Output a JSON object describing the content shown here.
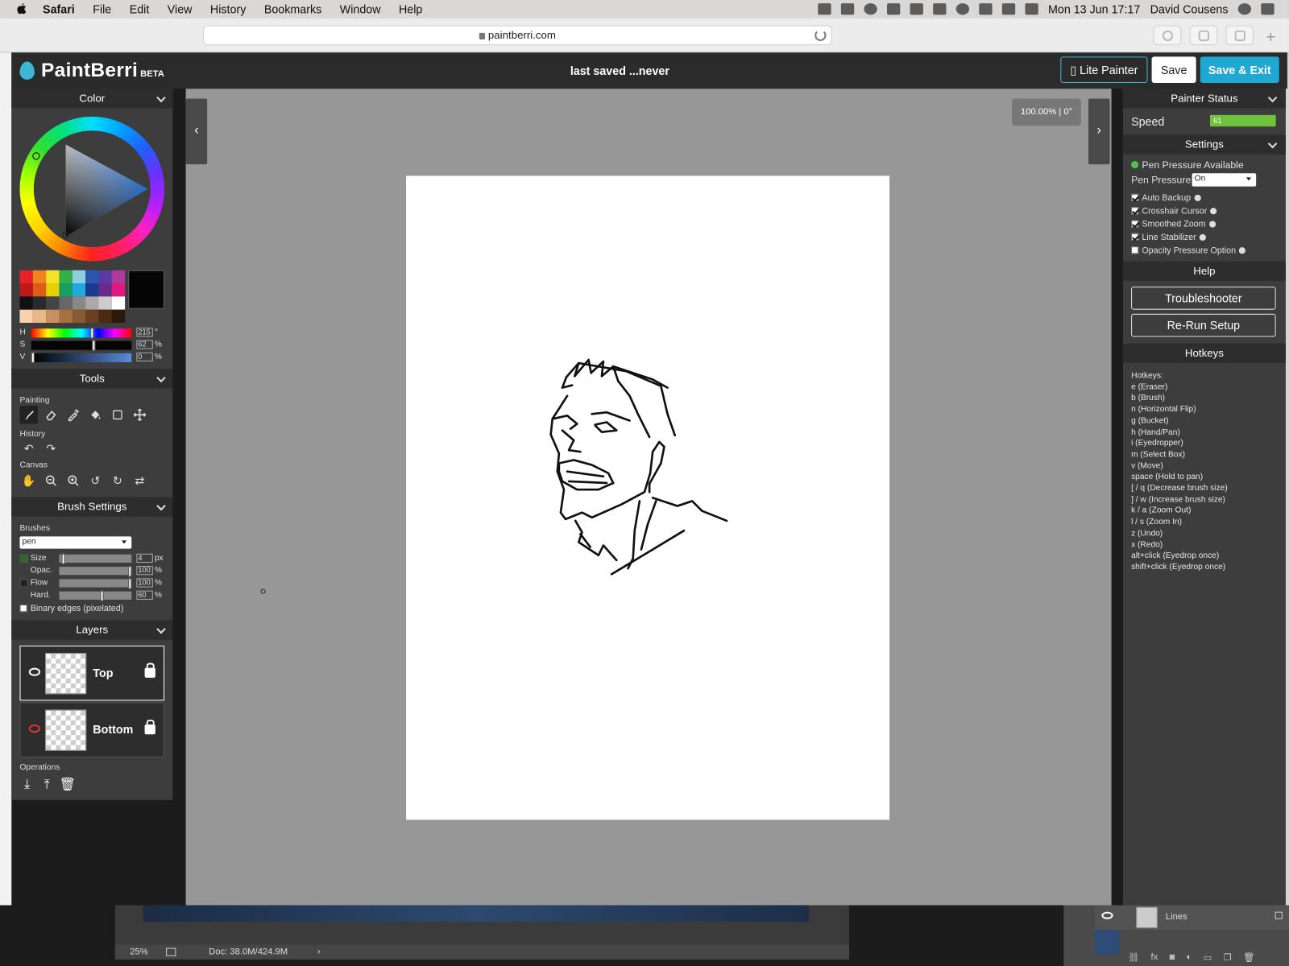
{
  "menubar": {
    "app": "Safari",
    "items": [
      "File",
      "Edit",
      "View",
      "History",
      "Bookmarks",
      "Window",
      "Help"
    ],
    "clock": "Mon 13 Jun  17:17",
    "user": "David Cousens"
  },
  "browser": {
    "url": "paintberri.com"
  },
  "header": {
    "logo": "PaintBerri",
    "beta": "BETA",
    "status": "last saved ...never",
    "lite_button": "▯ Lite Painter",
    "save_button": "Save",
    "save_exit_button": "Save & Exit"
  },
  "color_panel": {
    "title": "Color",
    "swatches": [
      "#e8202a",
      "#f08020",
      "#f4e22a",
      "#33b04a",
      "#8cd0e0",
      "#2a56b0",
      "#5a3aa0",
      "#b03a9a",
      "#c01818",
      "#e05a18",
      "#e8d000",
      "#16a060",
      "#20a8e0",
      "#1a3a90",
      "#6a2a8a",
      "#e01880",
      "#111111",
      "#2a2a2a",
      "#444444",
      "#666666",
      "#888888",
      "#aaaaaa",
      "#cccccc",
      "#ffffff",
      "#f8d0b0",
      "#e8b888",
      "#c89060",
      "#a87040",
      "#8a5a30",
      "#6a4020",
      "#4a2a10",
      "#2a1808"
    ],
    "hsv": {
      "h_label": "H",
      "s_label": "S",
      "v_label": "V",
      "h": "215",
      "s": "62",
      "v": "0",
      "h_unit": "°",
      "s_unit": "%",
      "v_unit": "%"
    }
  },
  "tools_panel": {
    "title": "Tools",
    "painting_label": "Painting",
    "history_label": "History",
    "canvas_label": "Canvas"
  },
  "brush_panel": {
    "title": "Brush Settings",
    "brushes_label": "Brushes",
    "brush_selected": "pen",
    "size_label": "Size",
    "size_value": "4",
    "size_unit": "px",
    "opac_label": "Opac.",
    "opac_value": "100",
    "opac_unit": "%",
    "flow_label": "Flow",
    "flow_value": "100",
    "flow_unit": "%",
    "hard_label": "Hard.",
    "hard_value": "60",
    "hard_unit": "%",
    "binary_label": "Binary edges (pixelated)"
  },
  "layers_panel": {
    "title": "Layers",
    "layers": [
      {
        "name": "Top"
      },
      {
        "name": "Bottom"
      }
    ],
    "operations_label": "Operations"
  },
  "canvas": {
    "zoom_readout": "100.00% | 0°"
  },
  "right_panel": {
    "status_title": "Painter Status",
    "speed_label": "Speed",
    "speed_value": "61",
    "settings_title": "Settings",
    "pen_available": "Pen Pressure Available",
    "pen_pressure_label": "Pen Pressure",
    "pen_pressure_value": "On",
    "options": [
      {
        "label": "Auto Backup",
        "checked": true
      },
      {
        "label": "Crosshair Cursor",
        "checked": true
      },
      {
        "label": "Smoothed Zoom",
        "checked": true
      },
      {
        "label": "Line Stabilizer",
        "checked": true
      },
      {
        "label": "Opacity Pressure Option",
        "checked": false
      }
    ],
    "help_title": "Help",
    "troubleshooter": "Troubleshooter",
    "rerun": "Re-Run Setup",
    "hotkeys_title": "Hotkeys",
    "hotkeys": [
      "Hotkeys:",
      "e (Eraser)",
      "b (Brush)",
      "n (Horizontal Flip)",
      "g (Bucket)",
      "h (Hand/Pan)",
      "i (Eyedropper)",
      "m (Select Box)",
      "v (Move)",
      "space (Hold to pan)",
      "[ / q (Decrease brush size)",
      "] / w (Increase brush size)",
      "k / a (Zoom Out)",
      "l / s (Zoom In)",
      "z (Undo)",
      "x (Redo)",
      "alt+click (Eyedrop once)",
      "shift+click (Eyedrop once)"
    ]
  },
  "photoshop": {
    "zoom": "25%",
    "doc": "Doc: 38.0M/424.9M",
    "layer_name": "Lines"
  }
}
